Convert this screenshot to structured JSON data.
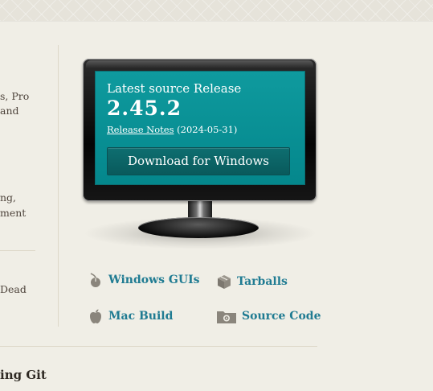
{
  "left_fragments": [
    "s, Pro",
    "and",
    "ng,",
    "ment",
    "Dead"
  ],
  "section_heading": "ing Git",
  "release": {
    "title": "Latest source Release",
    "version": "2.45.2",
    "notes_label": "Release Notes",
    "date": "(2024-05-31)",
    "download_label": "Download for Windows"
  },
  "links": [
    {
      "label": "Windows GUIs",
      "icon": "mouse-icon"
    },
    {
      "label": "Tarballs",
      "icon": "box-icon"
    },
    {
      "label": "Mac Build",
      "icon": "apple-icon"
    },
    {
      "label": "Source Code",
      "icon": "source-code-folder-icon"
    }
  ],
  "colors": {
    "background": "#f0eee6",
    "screen": "#0b9094",
    "button": "#0d6466",
    "link": "#1f7b92",
    "text": "#4e443c"
  }
}
